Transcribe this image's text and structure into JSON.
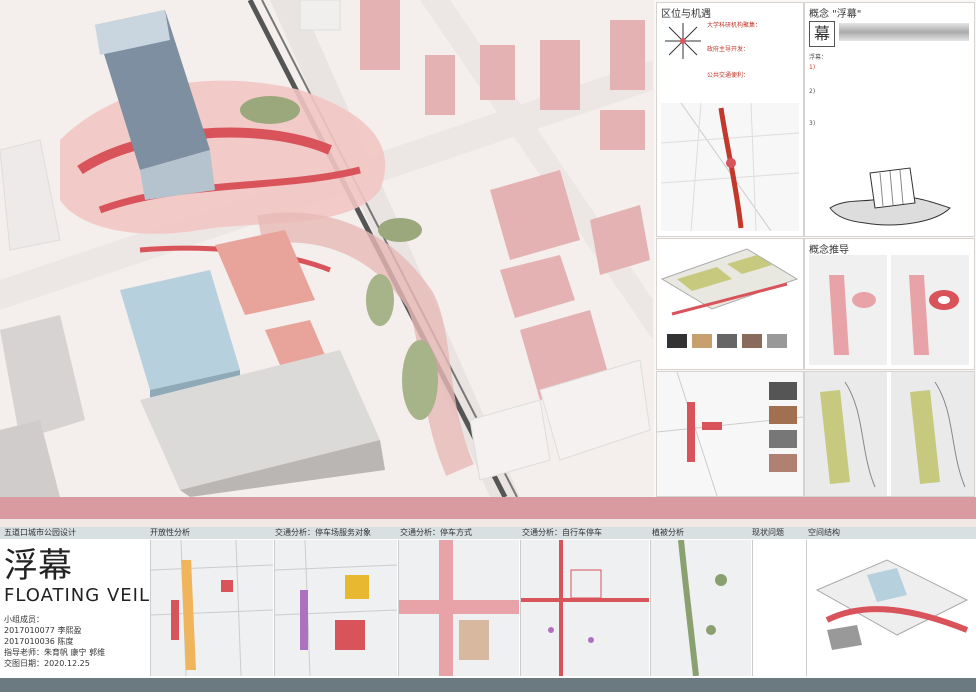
{
  "right_panels": {
    "location_title": "区位与机遇",
    "concept_title": "概念 \"浮幕\"",
    "concept_push_title": "概念推导",
    "location_notes": [
      "大学科研机构聚集：",
      "政府主导开发：",
      "公共交通便利："
    ],
    "concept_notes": [
      "浮幕：",
      "1)",
      "2)",
      "3)"
    ]
  },
  "bottom": {
    "project_site": "五道口城市公园设计",
    "title_cn": "浮幕",
    "title_en": "FLOATING VEIL",
    "team_label": "小组成员：",
    "member1": "2017010077  李熙盈",
    "member2": "2017010036  陈度",
    "advisor": "指导老师：朱育帆  康宁  郭维",
    "date": "交图日期：2020.12.25",
    "sections": [
      "开放性分析",
      "交通分析：停车场服务对象",
      "交通分析：停车方式",
      "交通分析：自行车停车",
      "植被分析",
      "现状问题",
      "空间结构"
    ]
  },
  "colors": {
    "accent_red": "#d9535a",
    "band_pink": "#d99aa0",
    "building_pink": "#e4b2b2",
    "glass_blue": "#a9c7d6"
  }
}
